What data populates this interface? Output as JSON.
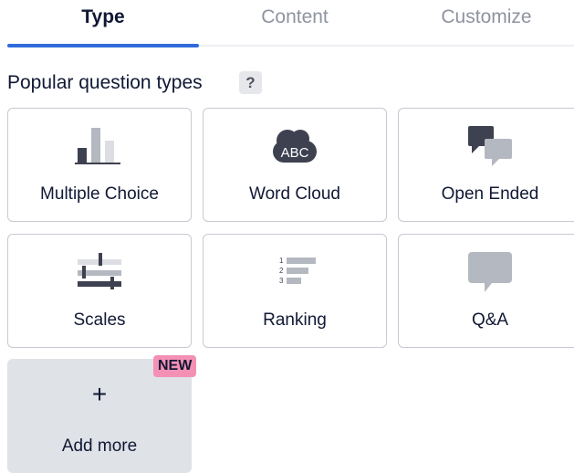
{
  "tabs": [
    {
      "label": "Type",
      "active": true
    },
    {
      "label": "Content",
      "active": false
    },
    {
      "label": "Customize",
      "active": false
    }
  ],
  "section": {
    "title": "Popular question types",
    "help_label": "?"
  },
  "cards": [
    {
      "label": "Multiple Choice",
      "icon": "bar-chart-icon"
    },
    {
      "label": "Word Cloud",
      "icon": "word-cloud-icon"
    },
    {
      "label": "Open Ended",
      "icon": "speech-bubbles-icon"
    },
    {
      "label": "Scales",
      "icon": "scales-icon"
    },
    {
      "label": "Ranking",
      "icon": "ranking-icon"
    },
    {
      "label": "Q&A",
      "icon": "qa-bubble-icon"
    }
  ],
  "cloud_text": "ABC",
  "ranking_numbers": [
    "1",
    "2",
    "3"
  ],
  "add_more": {
    "label": "Add more",
    "plus": "+",
    "badge": "NEW"
  },
  "colors": {
    "accent": "#2f6bdc",
    "dark_icon": "#3d4150",
    "grey_icon": "#b4b8c0",
    "light_icon": "#dcdee3",
    "new_badge": "#f590b5",
    "add_card_bg": "#dfe2e7"
  }
}
